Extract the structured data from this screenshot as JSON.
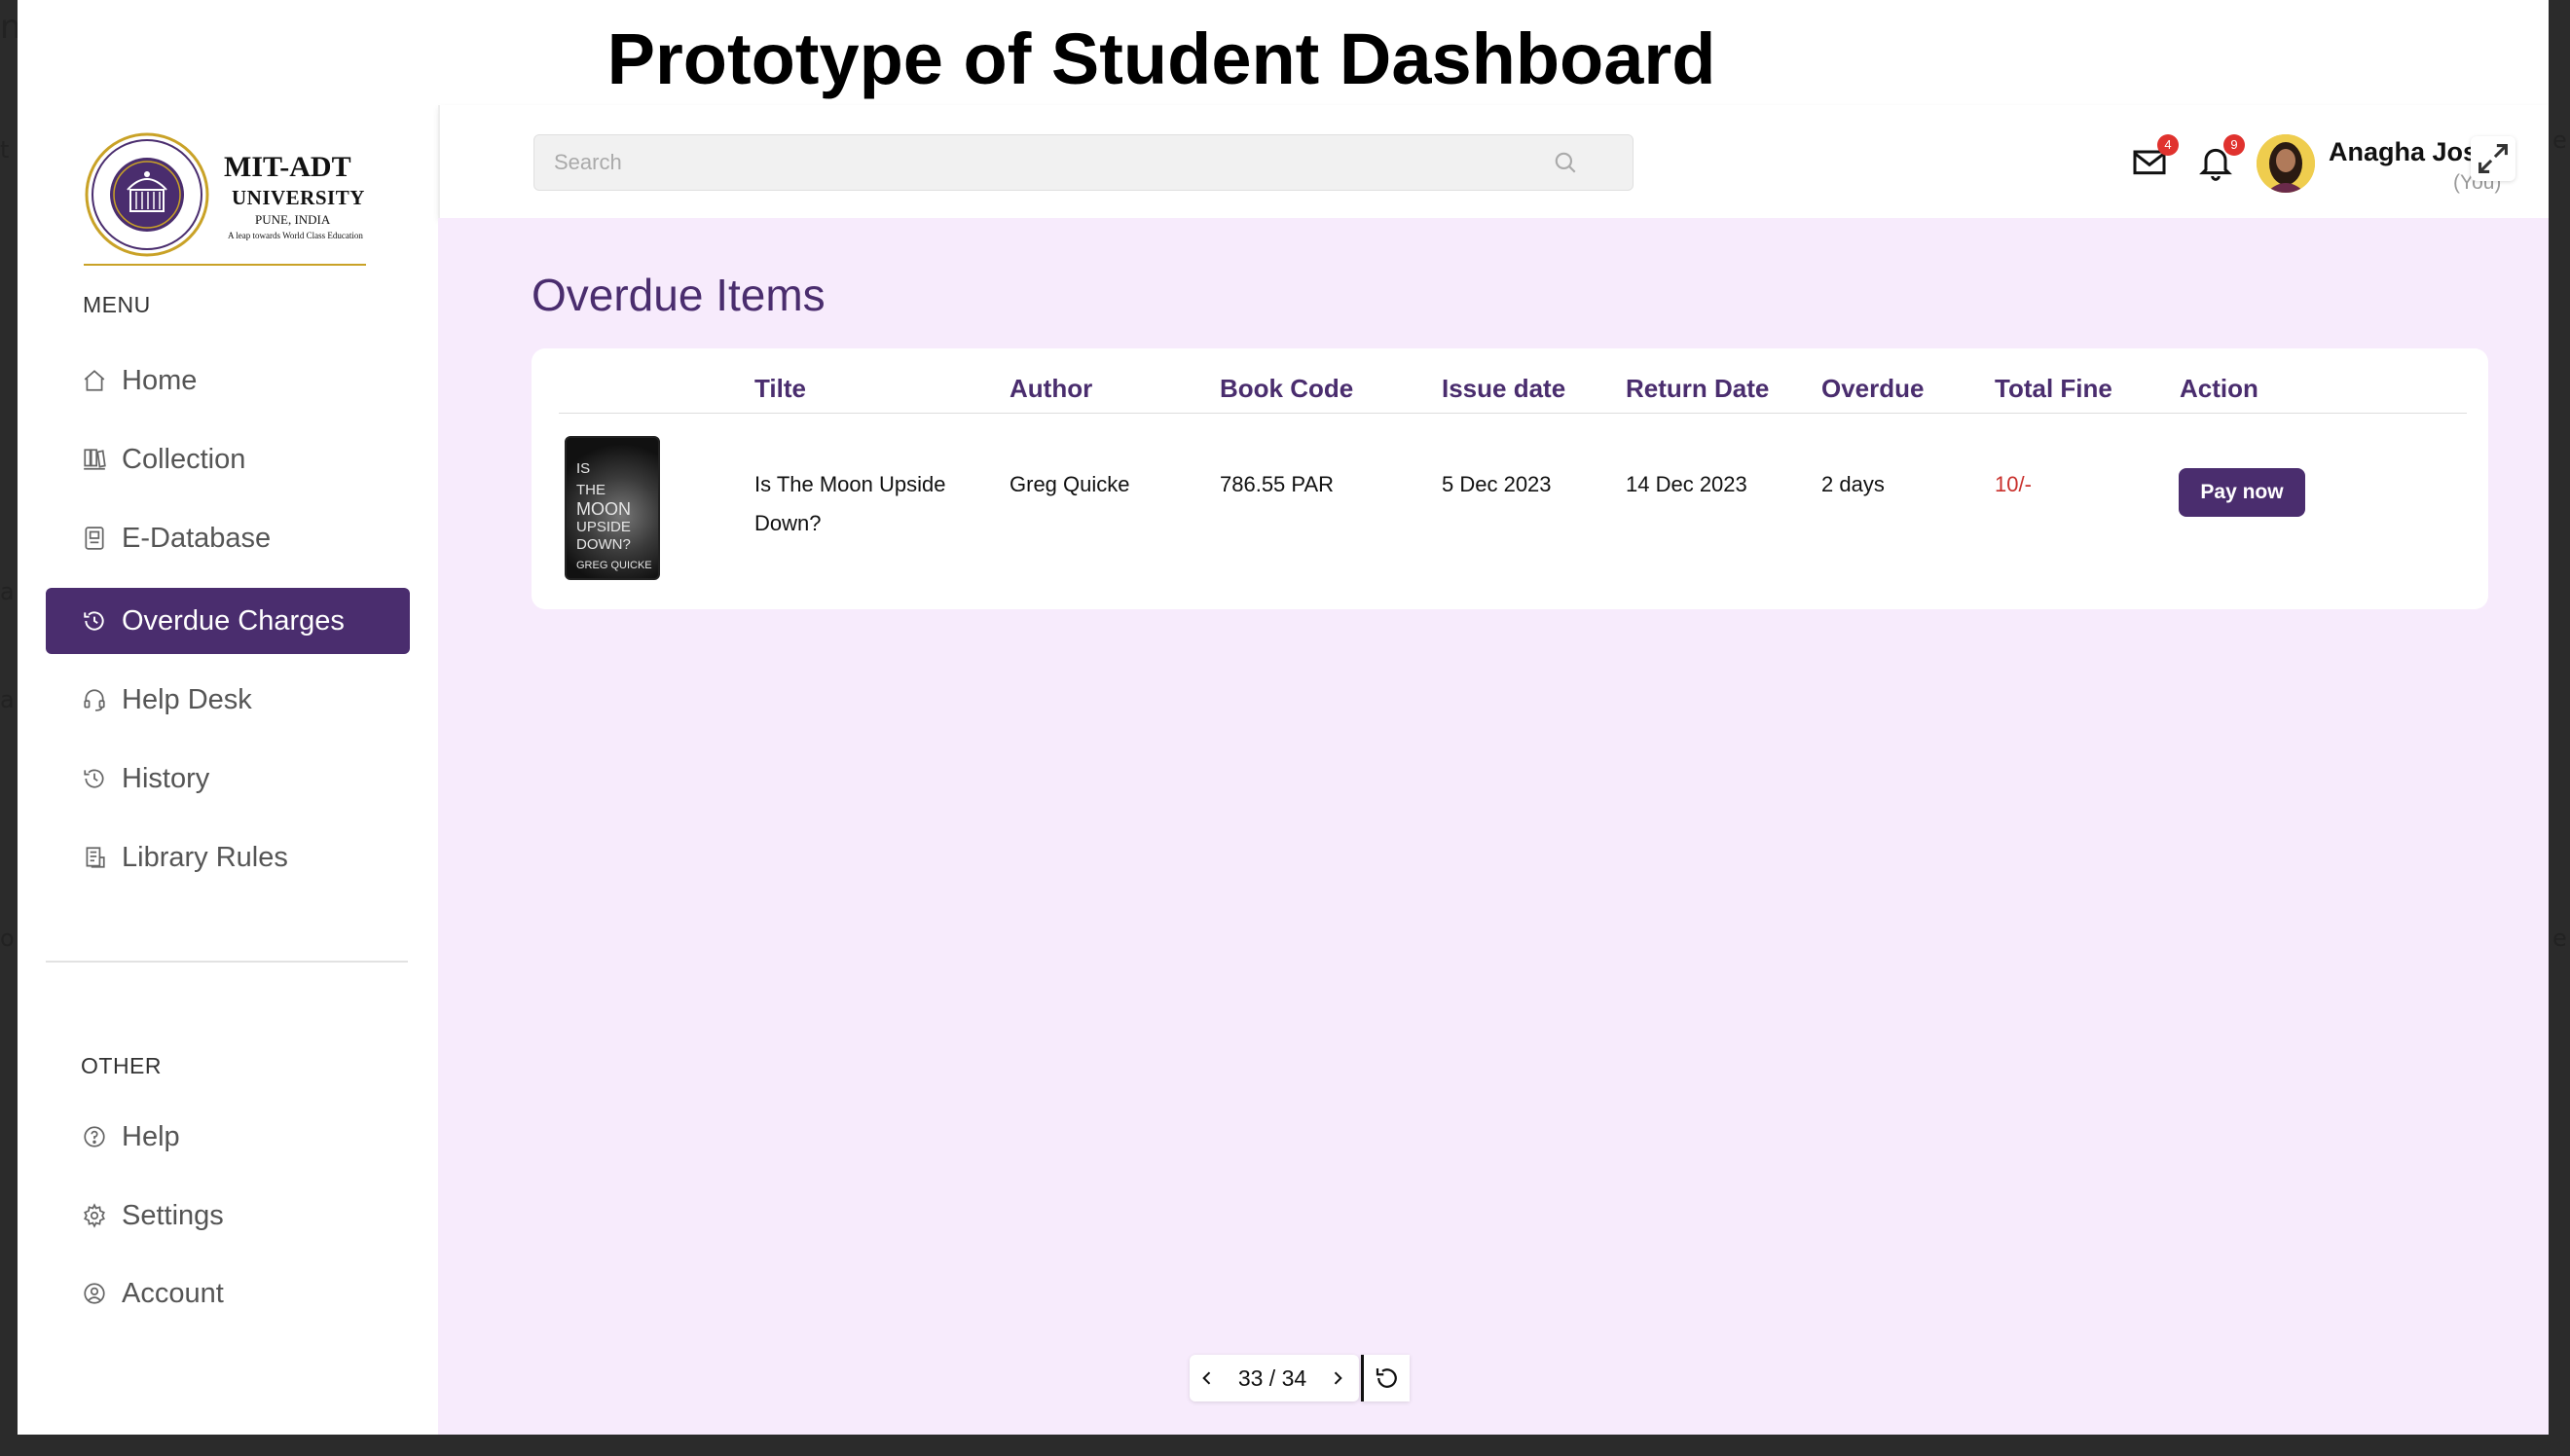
{
  "slide": {
    "title": "Prototype of Student Dashboard"
  },
  "logo": {
    "line1": "MIT-ADT",
    "line2": "UNIVERSITY",
    "line3": "PUNE, INDIA",
    "line4": "A leap towards World Class Education"
  },
  "sidebar": {
    "menu_label": "MENU",
    "menu_items": [
      {
        "label": "Home",
        "icon": "home-icon"
      },
      {
        "label": "Collection",
        "icon": "collection-icon"
      },
      {
        "label": "E-Database",
        "icon": "database-icon"
      },
      {
        "label": "Overdue Charges",
        "icon": "overdue-clock-icon",
        "active": true
      },
      {
        "label": "Help Desk",
        "icon": "headset-icon"
      },
      {
        "label": "History",
        "icon": "history-icon"
      },
      {
        "label": "Library Rules",
        "icon": "rules-icon"
      }
    ],
    "other_label": "OTHER",
    "other_items": [
      {
        "label": "Help",
        "icon": "help-icon"
      },
      {
        "label": "Settings",
        "icon": "gear-icon"
      },
      {
        "label": "Account",
        "icon": "account-icon"
      }
    ]
  },
  "topbar": {
    "search_placeholder": "Search",
    "mail_badge": "4",
    "notification_badge": "9",
    "user_name": "Anagha Joshi",
    "user_role": "(You)"
  },
  "main": {
    "title": "Overdue Items",
    "columns": [
      "Tilte",
      "Author",
      "Book Code",
      "Issue date",
      "Return Date",
      "Overdue",
      "Total Fine",
      "Action"
    ],
    "rows": [
      {
        "title_line1": "Is The Moon Upside",
        "title_line2": "Down?",
        "author": "Greg Quicke",
        "book_code": "786.55 PAR",
        "issue_date": "5 Dec 2023",
        "return_date": "14 Dec 2023",
        "overdue": "2 days",
        "total_fine": "10/-",
        "action": "Pay now",
        "cover": {
          "line1": "IS",
          "line2": "THE",
          "line3": "MOON",
          "line4": "UPSIDE",
          "line5": "DOWN?",
          "author": "GREG QUICKE"
        }
      }
    ]
  },
  "pager": {
    "text": "33 / 34"
  },
  "colors": {
    "accent": "#4a2d6e",
    "main_bg": "#f7ebfc",
    "fine_red": "#c9302c",
    "badge_red": "#e0322e"
  }
}
